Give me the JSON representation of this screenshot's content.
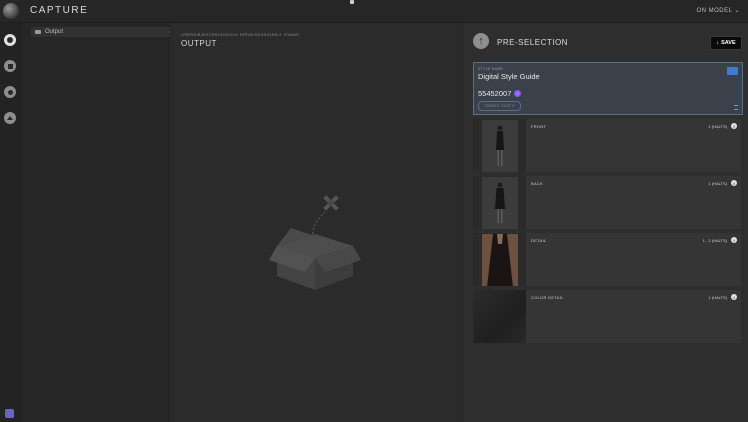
{
  "app": {
    "title": "CAPTURE",
    "mode_label": "ON MODEL"
  },
  "rail": {
    "icons": [
      "capture-icon",
      "folder-icon",
      "eye-icon",
      "upload-icon"
    ]
  },
  "folders": {
    "items": [
      {
        "label": "Output"
      }
    ]
  },
  "output": {
    "path": "USERS/BJESTER/GOOGLE DRIVE/SESSIONS/J. EVANS",
    "title": "OUTPUT"
  },
  "preselection": {
    "title": "PRE-SELECTION",
    "save_label": "SAVE",
    "style_card": {
      "label": "STYLE NAME",
      "name": "Digital Style Guide",
      "number": "55452007",
      "create_label": "CREATE OUTFIT"
    },
    "shots": [
      {
        "label": "FRONT",
        "count": "1 (HALTS)"
      },
      {
        "label": "BACK",
        "count": "1 (HALTS)"
      },
      {
        "label": "DETAIL",
        "count": "1 - 2 (HALTS)"
      },
      {
        "label": "COLOR DETAIL",
        "count": "1 (HALTS)"
      }
    ]
  },
  "colors": {
    "accent": "#5b6f85",
    "card_bg": "#3a414a",
    "badge": "#8b5cf6",
    "save_bg": "#0a0a0a"
  }
}
